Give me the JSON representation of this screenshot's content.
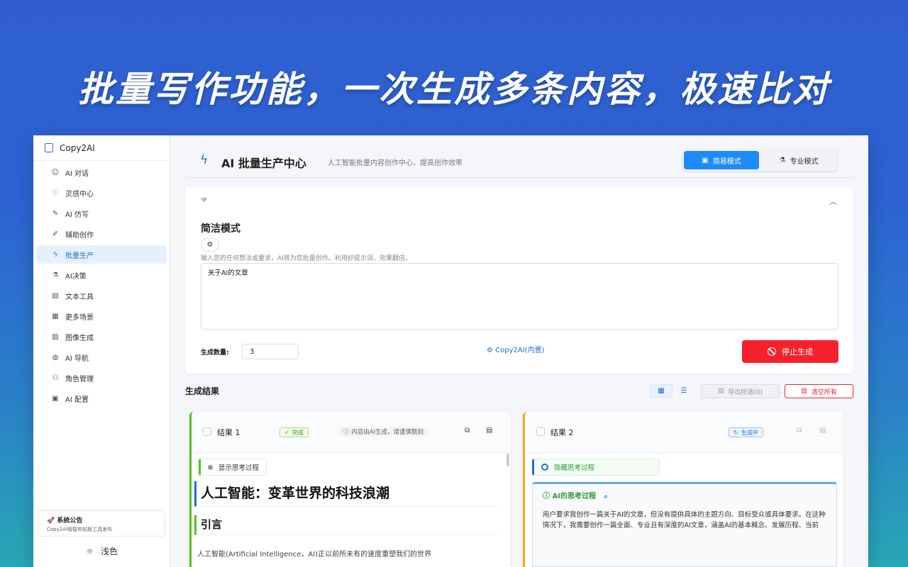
{
  "headline": "批量写作功能，一次生成多条内容，极速比对",
  "sidebar": {
    "brand": "Copy2AI",
    "items": [
      {
        "icon": "chat-icon",
        "glyph": "☺",
        "label": "AI 对话"
      },
      {
        "icon": "lightbulb-icon",
        "glyph": "♡",
        "label": "灵感中心"
      },
      {
        "icon": "pen-icon",
        "glyph": "✎",
        "label": "AI 仿写"
      },
      {
        "icon": "brush-icon",
        "glyph": "✐",
        "label": "辅助创作"
      },
      {
        "icon": "lightning-icon",
        "glyph": "ϟ",
        "label": "批量生产"
      },
      {
        "icon": "flask-icon",
        "glyph": "⚗",
        "label": "AI决策"
      },
      {
        "icon": "document-icon",
        "glyph": "▤",
        "label": "文本工具"
      },
      {
        "icon": "grid-icon",
        "glyph": "▦",
        "label": "更多场景"
      },
      {
        "icon": "image-icon",
        "glyph": "▨",
        "label": "图像生成"
      },
      {
        "icon": "globe-icon",
        "glyph": "◍",
        "label": "AI 导航"
      },
      {
        "icon": "users-icon",
        "glyph": "⚇",
        "label": "角色管理"
      },
      {
        "icon": "config-icon",
        "glyph": "▣",
        "label": "AI 配置"
      }
    ],
    "active_index": 4,
    "notice_title": "系统公告",
    "notice_text": "Copy2AI智能剪贴板工具发布",
    "theme_label": "浅色"
  },
  "header": {
    "title": "AI 批量生产中心",
    "subtitle": "人工智能批量内容创作中心，提高创作效率",
    "mode_simple": "简易模式",
    "mode_pro": "专业模式"
  },
  "panel": {
    "small_label": "ᵈP",
    "mode_title": "简洁模式",
    "hint": "输入您的任何想法或要求，AI将为您批量创作。利用好提示词，效果翻倍。",
    "prompt_value": "关于AI的文章",
    "count_label": "生成数量:",
    "count_value": "3",
    "model_label": "Copy2AI(内置)",
    "stop_label": "停止生成"
  },
  "results": {
    "title": "生成结果",
    "export_label": "导出所选(0)",
    "clear_label": "清空所有",
    "cards": [
      {
        "name": "结果 1",
        "status": "完成",
        "note": "内容由AI生成，请谨慎甄别",
        "think_toggle": "显示思考过程",
        "article_title": "人工智能：变革世界的科技浪潮",
        "article_section": "引言",
        "article_excerpt": "人工智能(Artificial Intelligence，AI)正以前所未有的速度重塑我们的世界"
      },
      {
        "name": "结果 2",
        "status": "生成中",
        "think_toggle": "隐藏思考过程",
        "think_title": "AI的思考过程",
        "think_body": "用户要求我创作一篇关于AI的文章，但没有提供具体的主题方向、目标受众或具体要求。在这种情况下，我需要创作一篇全面、专业且有深度的AI文章，涵盖AI的基本概念、发展历程、当前"
      }
    ]
  },
  "colors": {
    "accent": "#1d8cf8",
    "danger": "#f5222d",
    "success": "#52c41a",
    "warning": "#f5a623"
  }
}
